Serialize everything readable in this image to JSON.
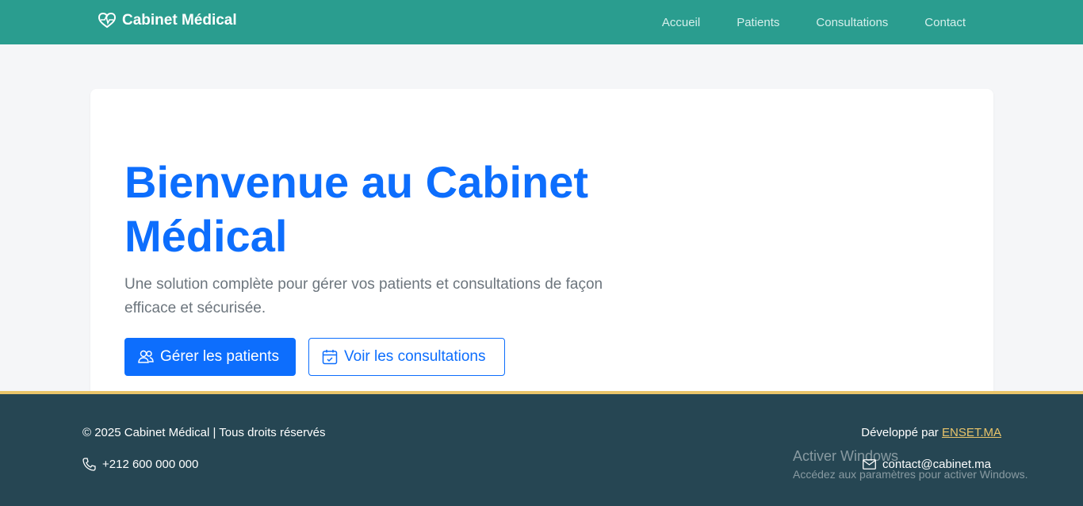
{
  "navbar": {
    "brand": "Cabinet Médical",
    "links": [
      "Accueil",
      "Patients",
      "Consultations",
      "Contact"
    ]
  },
  "hero": {
    "title": "Bienvenue au Cabinet Médical",
    "subtitle": "Une solution complète pour gérer vos patients et consultations de façon efficace et sécurisée.",
    "primary_button": "Gérer les patients",
    "secondary_button": "Voir les consultations"
  },
  "footer": {
    "copyright": "© 2025 Cabinet Médical | Tous droits réservés",
    "phone": "+212 600 000 000",
    "developed_by": "Développé par",
    "developer_link": "ENSET.MA",
    "email": "contact@cabinet.ma"
  },
  "watermark": {
    "title": "Activer Windows",
    "subtitle": "Accédez aux paramètres pour activer Windows."
  },
  "colors": {
    "navbar": "#2a9d8f",
    "primary": "#0d6efd",
    "footer": "#264653",
    "accent": "#e9c46a"
  },
  "icons": {
    "brand": "heart-pulse-icon",
    "patients": "people-icon",
    "consultations": "calendar-check-icon",
    "phone": "phone-icon",
    "email": "envelope-icon"
  }
}
